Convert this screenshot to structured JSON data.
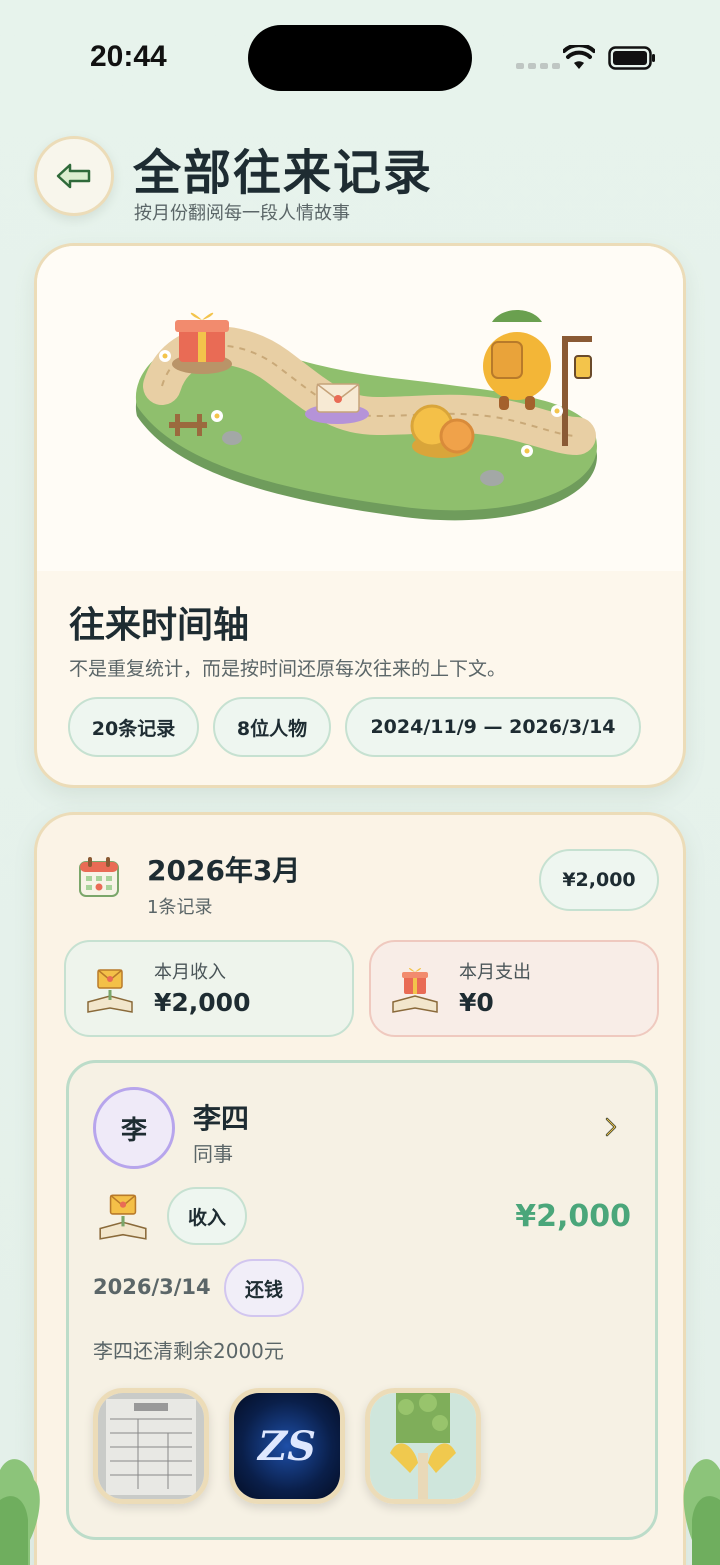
{
  "status": {
    "time": "20:44"
  },
  "header": {
    "title": "全部往来记录",
    "subtitle": "按月份翻阅每一段人情故事"
  },
  "hero": {
    "title": "往来时间轴",
    "description": "不是重复统计，而是按时间还原每次往来的上下文。",
    "chips": [
      "20条记录",
      "8位人物",
      "2024/11/9 — 2026/3/14"
    ]
  },
  "month": {
    "title": "2026年3月",
    "count": "1条记录",
    "total": "¥2,000",
    "income_label": "本月收入",
    "income_value": "¥2,000",
    "expense_label": "本月支出",
    "expense_value": "¥0"
  },
  "record": {
    "avatar_char": "李",
    "name": "李四",
    "role": "同事",
    "type_tag": "收入",
    "amount": "¥2,000",
    "date": "2026/3/14",
    "category_tag": "还钱",
    "note": "李四还清剩余2000元",
    "thumb_logo_text": "ZS"
  },
  "colors": {
    "income_green": "#4aa67a",
    "accent_border": "#ecdcb8",
    "avatar_border": "#b7a5ec"
  },
  "icons": [
    "back-arrow-icon",
    "calendar-icon",
    "income-envelope-icon",
    "expense-gift-icon",
    "chevron-right-icon"
  ]
}
